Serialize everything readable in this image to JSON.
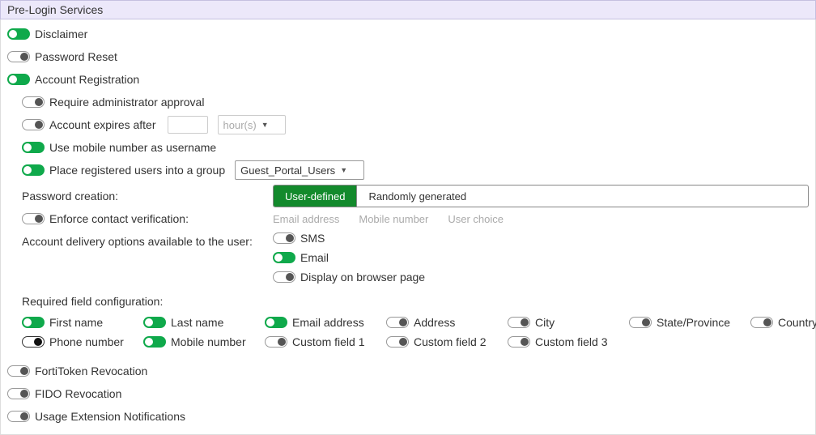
{
  "section_title": "Pre-Login Services",
  "toggles": {
    "disclaimer": "Disclaimer",
    "password_reset": "Password Reset",
    "account_registration": "Account Registration",
    "require_admin_approval": "Require administrator approval",
    "account_expires_after": "Account expires after",
    "use_mobile_as_username": "Use mobile number as username",
    "place_into_group": "Place registered users into a group",
    "enforce_verification": "Enforce contact verification:",
    "fortitoken_revocation": "FortiToken Revocation",
    "fido_revocation": "FIDO Revocation",
    "usage_extension": "Usage Extension Notifications"
  },
  "account_expires": {
    "value": "",
    "unit": "hour(s)"
  },
  "group_select": "Guest_Portal_Users",
  "password_creation": {
    "label": "Password creation:",
    "options": [
      "User-defined",
      "Randomly generated"
    ],
    "selected_index": 0
  },
  "verification_options": [
    "Email address",
    "Mobile number",
    "User choice"
  ],
  "delivery": {
    "label": "Account delivery options available to the user:",
    "options": {
      "sms": "SMS",
      "email": "Email",
      "browser": "Display on browser page"
    }
  },
  "required_fields": {
    "heading": "Required field configuration:",
    "fields": [
      {
        "label": "First name",
        "state": "on"
      },
      {
        "label": "Last name",
        "state": "on"
      },
      {
        "label": "Email address",
        "state": "on"
      },
      {
        "label": "Address",
        "state": "off"
      },
      {
        "label": "City",
        "state": "off"
      },
      {
        "label": "State/Province",
        "state": "off"
      },
      {
        "label": "Country",
        "state": "off"
      },
      {
        "label": "Phone number",
        "state": "on-black"
      },
      {
        "label": "Mobile number",
        "state": "on"
      },
      {
        "label": "Custom field 1",
        "state": "off"
      },
      {
        "label": "Custom field 2",
        "state": "off"
      },
      {
        "label": "Custom field 3",
        "state": "off"
      }
    ]
  }
}
